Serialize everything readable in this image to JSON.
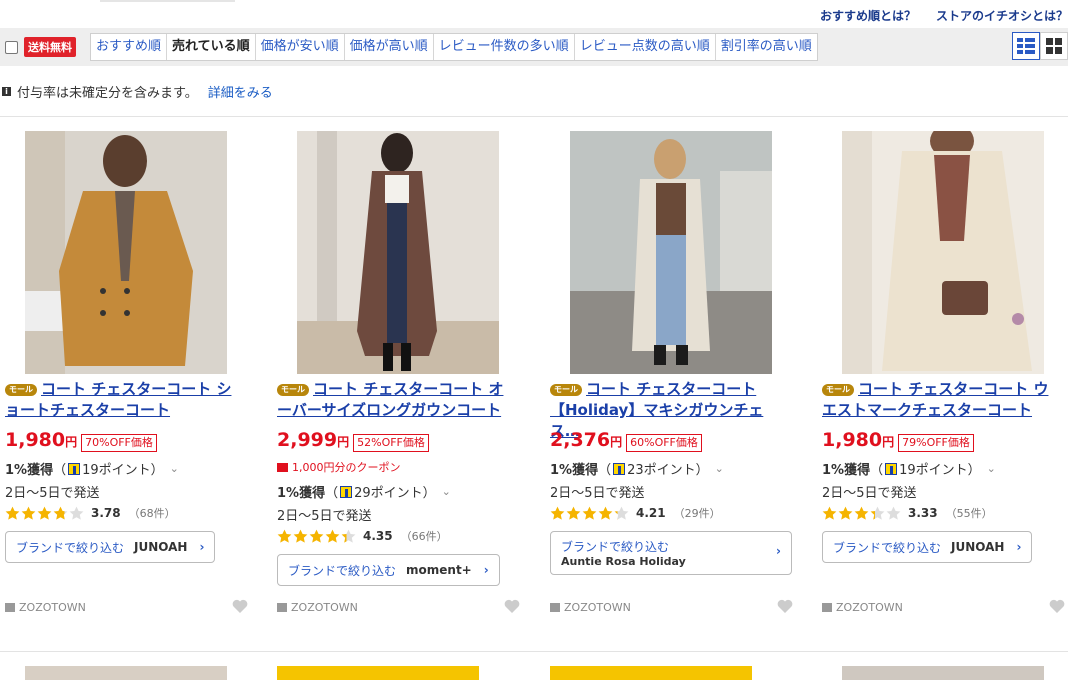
{
  "toplinks": [
    "おすすめ順とは？",
    "ストアのイチオシとは？"
  ],
  "filter": {
    "free_shipping_label": "送料無料"
  },
  "sort_options": [
    {
      "label": "おすすめ順",
      "active": false
    },
    {
      "label": "売れている順",
      "active": true
    },
    {
      "label": "価格が安い順",
      "active": false
    },
    {
      "label": "価格が高い順",
      "active": false
    },
    {
      "label": "レビュー件数の多い順",
      "active": false
    },
    {
      "label": "レビュー点数の高い順",
      "active": false
    },
    {
      "label": "割引率の高い順",
      "active": false
    }
  ],
  "notice": {
    "text": "付与率は未確定分を含みます。",
    "link": "詳細をみる"
  },
  "colors": {
    "price": "#e0101e",
    "link": "#1a3fa8",
    "star": "#f5b400"
  },
  "mall_badge": "モール",
  "products": [
    {
      "title": "コート チェスターコート ショートチェスターコート",
      "price": "1,980",
      "yen": "円",
      "discount": "70%OFF価格",
      "coupon": "",
      "points_bold": "1%獲得",
      "points_rest": "19ポイント）",
      "shipping": "2日〜5日で発送",
      "rating": "3.78",
      "stars": 3.78,
      "reviews": "（68件）",
      "brand_label": "ブランドで絞り込む",
      "brand": "JUNOAH",
      "store": "ZOZOTOWN"
    },
    {
      "title": "コート チェスターコート オーバーサイズロングガウンコート",
      "price": "2,999",
      "yen": "円",
      "discount": "52%OFF価格",
      "coupon": "1,000円分のクーポン",
      "points_bold": "1%獲得",
      "points_rest": "29ポイント）",
      "shipping": "2日〜5日で発送",
      "rating": "4.35",
      "stars": 4.35,
      "reviews": "（66件）",
      "brand_label": "ブランドで絞り込む",
      "brand": "moment+",
      "store": "ZOZOTOWN"
    },
    {
      "title": "コート チェスターコート 【Holiday】マキシガウンチェス…",
      "price": "2,376",
      "yen": "円",
      "discount": "60%OFF価格",
      "coupon": "",
      "points_bold": "1%獲得",
      "points_rest": "23ポイント）",
      "shipping": "2日〜5日で発送",
      "rating": "4.21",
      "stars": 4.21,
      "reviews": "（29件）",
      "brand_label": "ブランドで絞り込む",
      "brand": "Auntie Rosa Holiday",
      "store": "ZOZOTOWN"
    },
    {
      "title": "コート チェスターコート ウエストマークチェスターコート",
      "price": "1,980",
      "yen": "円",
      "discount": "79%OFF価格",
      "coupon": "",
      "points_bold": "1%獲得",
      "points_rest": "19ポイント）",
      "shipping": "2日〜5日で発送",
      "rating": "3.33",
      "stars": 3.33,
      "reviews": "（55件）",
      "brand_label": "ブランドで絞り込む",
      "brand": "JUNOAH",
      "store": "ZOZOTOWN"
    }
  ]
}
